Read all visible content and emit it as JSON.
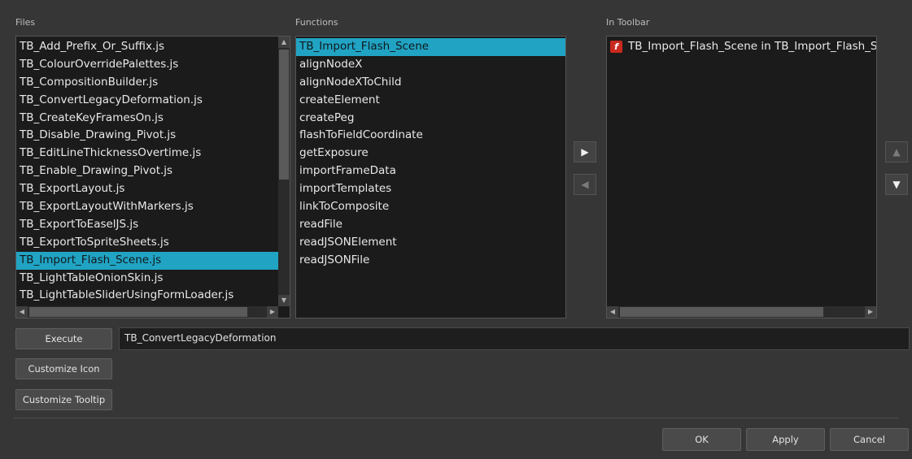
{
  "files": {
    "label": "Files",
    "items": [
      "TB_Add_Prefix_Or_Suffix.js",
      "TB_ColourOverridePalettes.js",
      "TB_CompositionBuilder.js",
      "TB_ConvertLegacyDeformation.js",
      "TB_CreateKeyFramesOn.js",
      "TB_Disable_Drawing_Pivot.js",
      "TB_EditLineThicknessOvertime.js",
      "TB_Enable_Drawing_Pivot.js",
      "TB_ExportLayout.js",
      "TB_ExportLayoutWithMarkers.js",
      "TB_ExportToEaselJS.js",
      "TB_ExportToSpriteSheets.js",
      "TB_Import_Flash_Scene.js",
      "TB_LightTableOnionSkin.js",
      "TB_LightTableSliderUsingFormLoader.js"
    ],
    "selected_index": 12
  },
  "functions": {
    "label": "Functions",
    "items": [
      "TB_Import_Flash_Scene",
      "alignNodeX",
      "alignNodeXToChild",
      "createElement",
      "createPeg",
      "flashToFieldCoordinate",
      "getExposure",
      "importFrameData",
      "importTemplates",
      "linkToComposite",
      "readFile",
      "readJSONElement",
      "readJSONFile"
    ],
    "selected_index": 0
  },
  "toolbar": {
    "label": "In Toolbar",
    "items": [
      {
        "icon": "flash-icon",
        "text": "TB_Import_Flash_Scene in TB_Import_Flash_Scene.js"
      }
    ]
  },
  "icons": {
    "add": "play-right-icon",
    "remove": "play-left-icon",
    "up": "triangle-up-icon",
    "down": "triangle-down-icon"
  },
  "execute": {
    "button_label": "Execute",
    "field_value": "TB_ConvertLegacyDeformation"
  },
  "customize_icon_label": "Customize Icon",
  "customize_tooltip_label": "Customize Tooltip",
  "footer": {
    "ok_label": "OK",
    "apply_label": "Apply",
    "cancel_label": "Cancel"
  },
  "colors": {
    "background": "#363636",
    "list_background": "#1b1b1b",
    "selection": "#21a3c3"
  }
}
